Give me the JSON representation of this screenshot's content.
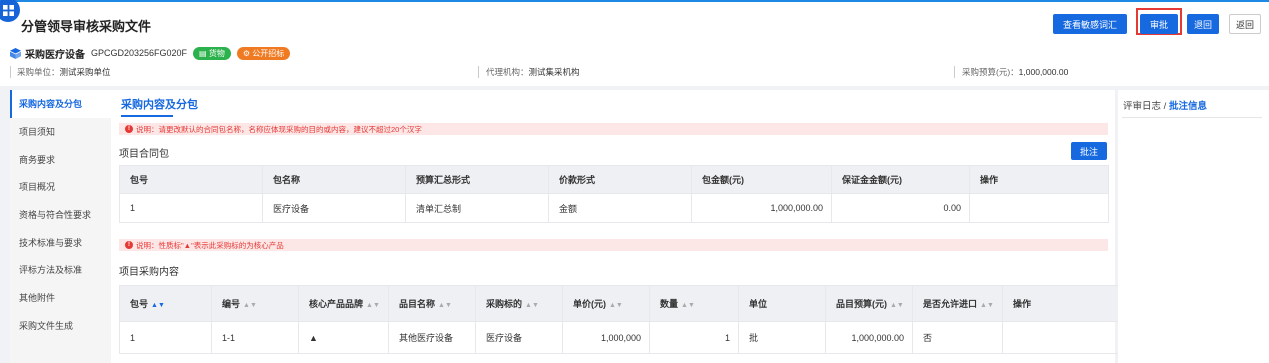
{
  "header": {
    "title": "分管领导审核采购文件",
    "buttons": {
      "view_sensitive": "查看敏感词汇",
      "approve": "审批",
      "return": "退回",
      "back": "返回"
    }
  },
  "project": {
    "name": "采购医疗设备",
    "code": "GPCGD203256FG020F",
    "tags": [
      "货物",
      "公开招标"
    ]
  },
  "info": {
    "unit_label": "采购单位：",
    "unit_value": "测试采购单位",
    "agency_label": "代理机构：",
    "agency_value": "测试集采机构",
    "budget_label": "采购预算(元)：",
    "budget_value": "1,000,000.00"
  },
  "sidebar": {
    "items": [
      {
        "label": "采购内容及分包",
        "active": true
      },
      {
        "label": "项目须知"
      },
      {
        "label": "商务要求"
      },
      {
        "label": "项目概况"
      },
      {
        "label": "资格与符合性要求"
      },
      {
        "label": "技术标准与要求"
      },
      {
        "label": "评标方法及标准"
      },
      {
        "label": "其他附件"
      },
      {
        "label": "采购文件生成"
      }
    ]
  },
  "main": {
    "section_title": "采购内容及分包",
    "notice1": "说明：请更改默认的合同包名称，名称应体现采购的目的或内容，建议不超过20个汉字",
    "contract_title": "项目合同包",
    "annotate_label": "批注",
    "contract_table": {
      "headers": [
        "包号",
        "包名称",
        "预算汇总形式",
        "价款形式",
        "包金额(元)",
        "保证金金额(元)",
        "操作"
      ],
      "rows": [
        [
          "1",
          "医疗设备",
          "清单汇总制",
          "金额",
          "1,000,000.00",
          "0.00",
          ""
        ]
      ]
    },
    "notice2": "说明：性质标\"▲\"表示此采购标的为核心产品",
    "items_title": "项目采购内容",
    "items_table": {
      "headers": [
        "包号",
        "编号",
        "核心产品品牌",
        "品目名称",
        "采购标的",
        "单价(元)",
        "数量",
        "单位",
        "品目预算(元)",
        "是否允许进口",
        "操作"
      ],
      "rows": [
        [
          "1",
          "1-1",
          "▲",
          "其他医疗设备",
          "医疗设备",
          "1,000,000",
          "1",
          "批",
          "1,000,000.00",
          "否",
          ""
        ]
      ]
    }
  },
  "log_panel": {
    "tab1": "评审日志",
    "sep": " / ",
    "tab2": "批注信息"
  },
  "colors": {
    "accent": "#1769e0",
    "alert": "#e53935",
    "tag_green": "#2bb24c",
    "tag_orange": "#f07a22"
  }
}
